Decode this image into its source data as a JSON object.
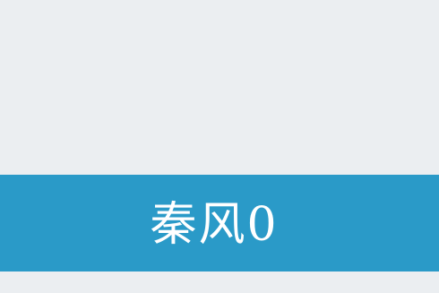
{
  "banner": {
    "label": "秦风0"
  },
  "colors": {
    "background": "#ebeef1",
    "banner": "#2a9ac8",
    "banner_text": "#ffffff"
  }
}
